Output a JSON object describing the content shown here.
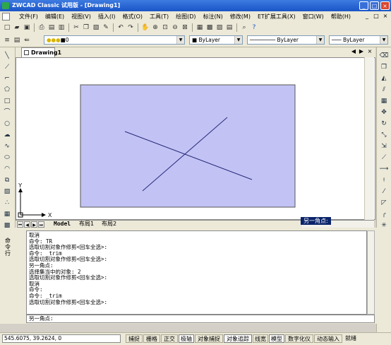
{
  "window": {
    "title": "ZWCAD Classic 试用版 - [Drawing1]",
    "controls": [
      "_",
      "□",
      "×"
    ]
  },
  "menu": {
    "items": [
      "文件(F)",
      "编辑(E)",
      "视图(V)",
      "插入(I)",
      "格式(O)",
      "工具(T)",
      "绘图(D)",
      "标注(N)",
      "修改(M)",
      "ET扩展工具(X)",
      "窗口(W)",
      "帮助(H)"
    ],
    "mdi_controls": [
      "_",
      "□",
      "×"
    ]
  },
  "properties": {
    "layer": "0",
    "color": "ByLayer",
    "linetype": "ByLayer",
    "lineweight": "ByLayer"
  },
  "document": {
    "tab": "Drawing1",
    "tab_controls": [
      "◀",
      "▶",
      "×"
    ]
  },
  "drawing": {
    "background": "#ffffff",
    "viewport_fill": "#c2c3f4",
    "line_color": "#2a2a7a",
    "ucs": {
      "x_label": "X",
      "y_label": "Y"
    }
  },
  "layout_tabs": [
    "Model",
    "布局1",
    "布局2"
  ],
  "tooltip": "另一角点:",
  "command": {
    "panel_label": "命令行",
    "history": [
      "取消",
      "命令: TR",
      "选取切割对象作修剪<回车全选>:",
      "命令: _trim",
      "选取切割对象作修剪<回车全选>:",
      "另一角点:",
      "选择集当中的对象: 2",
      "选取切割对象作修剪<回车全选>:",
      "取消",
      "命令:",
      "命令: _trim",
      "选取切割对象作修剪<回车全选>:"
    ],
    "input": "另一角点:"
  },
  "status": {
    "coords": "545.6075,  39.2624,  0",
    "buttons": [
      {
        "label": "捕捉",
        "on": false
      },
      {
        "label": "栅格",
        "on": false
      },
      {
        "label": "正交",
        "on": false
      },
      {
        "label": "极轴",
        "on": true
      },
      {
        "label": "对象捕捉",
        "on": false
      },
      {
        "label": "对象追踪",
        "on": true
      },
      {
        "label": "线宽",
        "on": false
      },
      {
        "label": "模型",
        "on": true
      },
      {
        "label": "数字化仪",
        "on": false
      },
      {
        "label": "动态输入",
        "on": false
      },
      {
        "label": "就绪",
        "on": false
      }
    ]
  }
}
